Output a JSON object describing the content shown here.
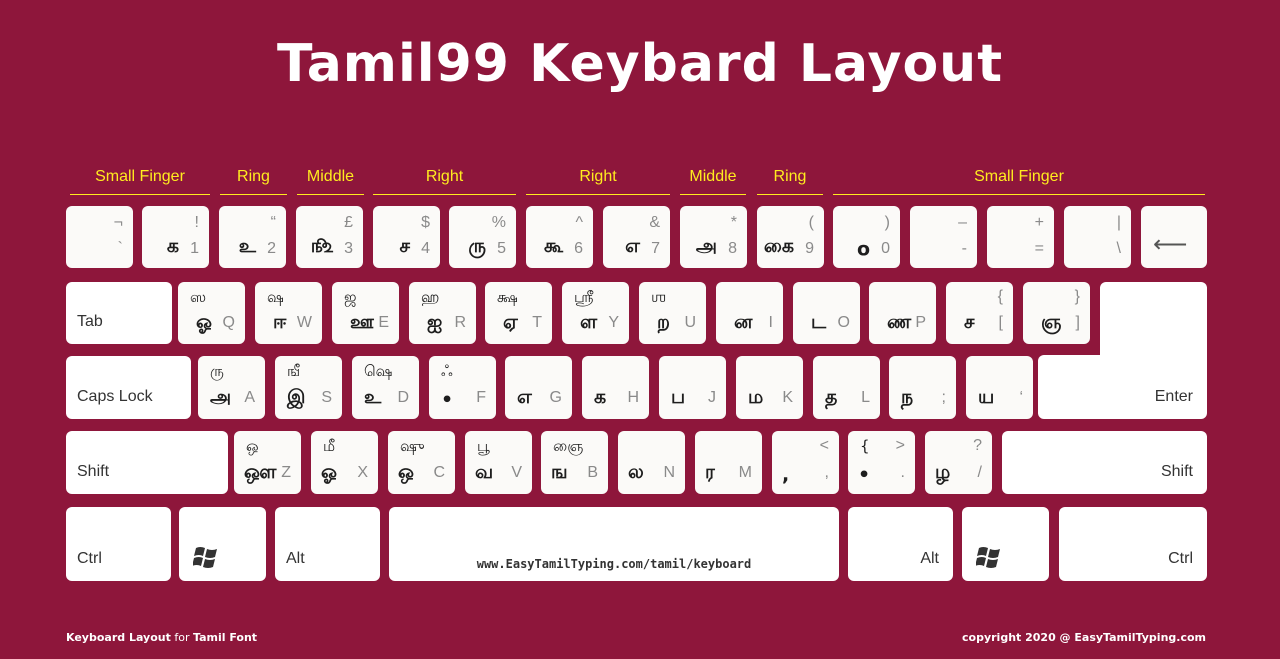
{
  "title": "Tamil99 Keybard Layout",
  "fingers": [
    {
      "label": "Small Finger"
    },
    {
      "label": "Ring"
    },
    {
      "label": "Middle"
    },
    {
      "label": "Right"
    },
    {
      "label": "Right"
    },
    {
      "label": "Middle"
    },
    {
      "label": "Ring"
    },
    {
      "label": "Small Finger"
    }
  ],
  "rows": {
    "number": [
      {
        "tamil": "",
        "shift_sym": "¬",
        "latin": "`"
      },
      {
        "tamil": "க",
        "shift_sym": "!",
        "latin": "1"
      },
      {
        "tamil": "உ",
        "shift_sym": "“",
        "latin": "2"
      },
      {
        "tamil": "௺",
        "shift_sym": "£",
        "latin": "3"
      },
      {
        "tamil": "ச",
        "shift_sym": "$",
        "latin": "4"
      },
      {
        "tamil": "ரு",
        "shift_sym": "%",
        "latin": "5"
      },
      {
        "tamil": "கூ",
        "shift_sym": "^",
        "latin": "6"
      },
      {
        "tamil": "எ",
        "shift_sym": "&",
        "latin": "7"
      },
      {
        "tamil": "அ",
        "shift_sym": "*",
        "latin": "8"
      },
      {
        "tamil": "கை",
        "shift_sym": "(",
        "latin": "9"
      },
      {
        "tamil": "ο",
        "shift_sym": ")",
        "latin": "0"
      },
      {
        "tamil": "",
        "shift_sym": "–",
        "latin": "-"
      },
      {
        "tamil": "",
        "shift_sym": "+",
        "latin": "="
      },
      {
        "tamil": "",
        "shift_sym": "|",
        "latin": "\\"
      }
    ],
    "top": [
      {
        "tamil_shift": "ஸ",
        "tamil": "ஓ",
        "latin": "Q"
      },
      {
        "tamil_shift": "ஷ",
        "tamil": "ஈ",
        "latin": "W"
      },
      {
        "tamil_shift": "ஜ",
        "tamil": "ஊ",
        "latin": "E"
      },
      {
        "tamil_shift": "ஹ",
        "tamil": "ஐ",
        "latin": "R"
      },
      {
        "tamil_shift": "க்ஷ",
        "tamil": "ஏ",
        "latin": "T"
      },
      {
        "tamil_shift": "ஸ்ரீ",
        "tamil": "ள",
        "latin": "Y"
      },
      {
        "tamil_shift": "ஶ",
        "tamil": "ற",
        "latin": "U"
      },
      {
        "tamil_shift": "",
        "tamil": "ன",
        "latin": "I"
      },
      {
        "tamil_shift": "",
        "tamil": "ட",
        "latin": "O"
      },
      {
        "tamil_shift": "",
        "tamil": "ண",
        "latin": "P"
      },
      {
        "tamil_shift": "",
        "tamil": "ச",
        "latin": "[",
        "latin_shift": "{"
      },
      {
        "tamil_shift": "",
        "tamil": "ஞ",
        "latin": "]",
        "latin_shift": "}"
      }
    ],
    "home": [
      {
        "tamil_shift": "ரு",
        "tamil": "அ",
        "latin": "A"
      },
      {
        "tamil_shift": "ஙீ",
        "tamil": "இ",
        "latin": "S"
      },
      {
        "tamil_shift": "ஷெ",
        "tamil": "உ",
        "latin": "D"
      },
      {
        "tamil_shift": "ஃ",
        "tamil": "•",
        "latin": "F"
      },
      {
        "tamil_shift": "",
        "tamil": "எ",
        "latin": "G"
      },
      {
        "tamil_shift": "",
        "tamil": "க",
        "latin": "H"
      },
      {
        "tamil_shift": "",
        "tamil": "ப",
        "latin": "J"
      },
      {
        "tamil_shift": "",
        "tamil": "ம",
        "latin": "K"
      },
      {
        "tamil_shift": "",
        "tamil": "த",
        "latin": "L"
      },
      {
        "tamil_shift": "",
        "tamil": "ந",
        "latin": ";"
      },
      {
        "tamil_shift": "",
        "tamil": "ய",
        "latin": "‘"
      }
    ],
    "bottom": [
      {
        "tamil_shift": "ஒ",
        "tamil": "ஔ",
        "latin": "Z"
      },
      {
        "tamil_shift": "மீ",
        "tamil": "ஓ",
        "latin": "X"
      },
      {
        "tamil_shift": "ஷு",
        "tamil": "ஒ",
        "latin": "C"
      },
      {
        "tamil_shift": "பூ",
        "tamil": "வ",
        "latin": "V"
      },
      {
        "tamil_shift": "ஞை",
        "tamil": "ங",
        "latin": "B"
      },
      {
        "tamil_shift": "",
        "tamil": "ல",
        "latin": "N"
      },
      {
        "tamil_shift": "",
        "tamil": "ர",
        "latin": "M"
      },
      {
        "tamil_shift": "",
        "tamil": ",",
        "latin": ",",
        "latin_shift": "<"
      },
      {
        "tamil_shift": "{",
        "tamil": "•",
        "latin": ".",
        "latin_shift": ">"
      },
      {
        "tamil_shift": "",
        "tamil": "ழ",
        "latin": "/",
        "latin_shift": "?"
      }
    ]
  },
  "modifiers": {
    "tab": "Tab",
    "caps_lock": "Caps Lock",
    "enter": "Enter",
    "shift_left": "Shift",
    "shift_right": "Shift",
    "ctrl_left": "Ctrl",
    "alt_left": "Alt",
    "alt_right": "Alt",
    "ctrl_right": "Ctrl",
    "backspace_icon": "arrow-left",
    "windows_icon": "windows-logo"
  },
  "spacebar_text": "www.EasyTamilTyping.com/tamil/keyboard",
  "footer": {
    "left_bold1": "Keyboard Layout",
    "left_mid": " for ",
    "left_bold2": "Tamil Font",
    "right": "copyright 2020 @ EasyTamilTyping.com"
  }
}
